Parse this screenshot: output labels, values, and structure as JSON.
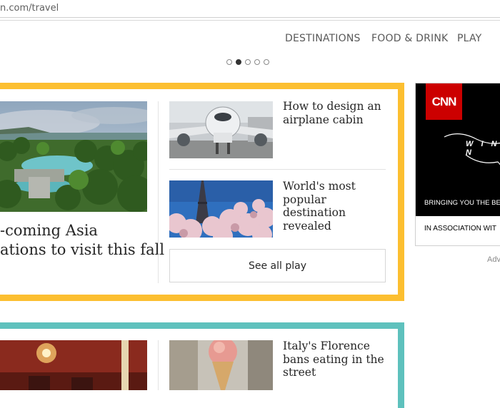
{
  "browser": {
    "url_text": "n.com/travel"
  },
  "nav": {
    "items": [
      {
        "label": "DESTINATIONS"
      },
      {
        "label": "FOOD & DRINK"
      },
      {
        "label": "PLAY"
      }
    ]
  },
  "carousel": {
    "total": 5,
    "active_index": 1
  },
  "card1": {
    "accent": "#fcbf30",
    "hero": {
      "title_line1": "-coming Asia",
      "title_line2": "ations to visit this fall"
    },
    "stories": [
      {
        "title": "How to design an airplane cabin"
      },
      {
        "title": "World's most popular destination revealed"
      }
    ],
    "see_all": "See all play"
  },
  "card2": {
    "accent": "#5ec1bd",
    "stories": [
      {
        "title": "Italy's Florence bans eating in the street"
      }
    ]
  },
  "ad": {
    "logo": "CNN",
    "headline_fragment": "W I N N",
    "tagline": "BRINGING YOU THE BEST I",
    "association": "IN ASSOCIATION WIT",
    "label": "Adv"
  },
  "colors": {
    "cnn_red": "#cc0000",
    "nav_text": "#595959"
  }
}
